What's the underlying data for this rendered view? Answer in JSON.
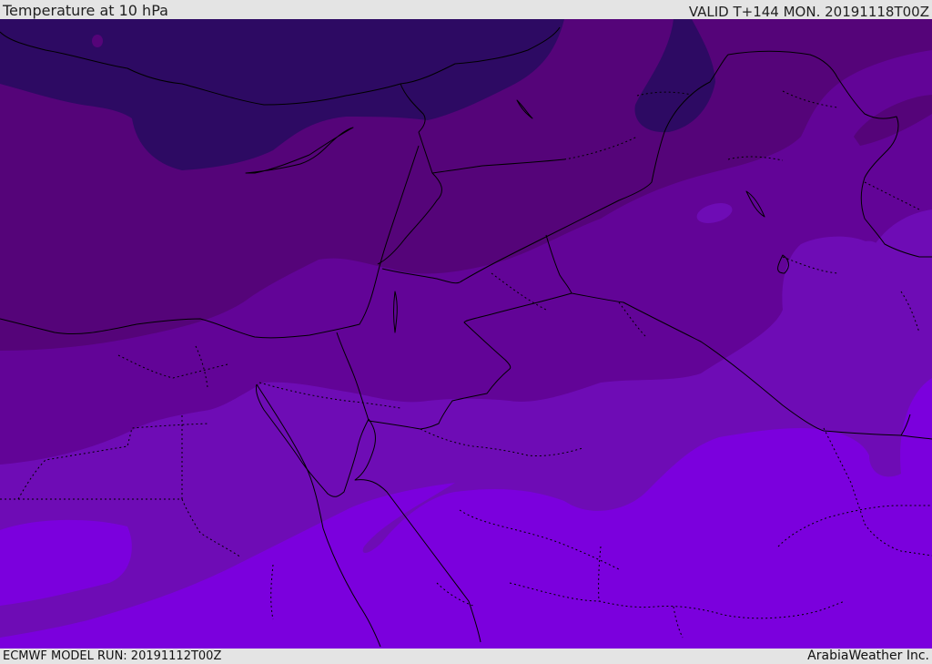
{
  "header": {
    "title": "Temperature at 10 hPa",
    "valid": "VALID T+144 MON. 20191118T00Z"
  },
  "footer": {
    "model_run": "ECMWF MODEL RUN: 20191112T00Z",
    "credit": "ArabiaWeather Inc."
  },
  "colors": {
    "band_darkest": "#2d0a63",
    "band_dark": "#550479",
    "band_mid": "#620497",
    "band_light": "#6e0cb5",
    "band_lightest": "#7b00dd",
    "borders": "#000000",
    "bar_background": "#e4e4e4"
  },
  "map_layers": [
    "temperature-shading",
    "coastlines",
    "country-borders",
    "province-borders"
  ]
}
